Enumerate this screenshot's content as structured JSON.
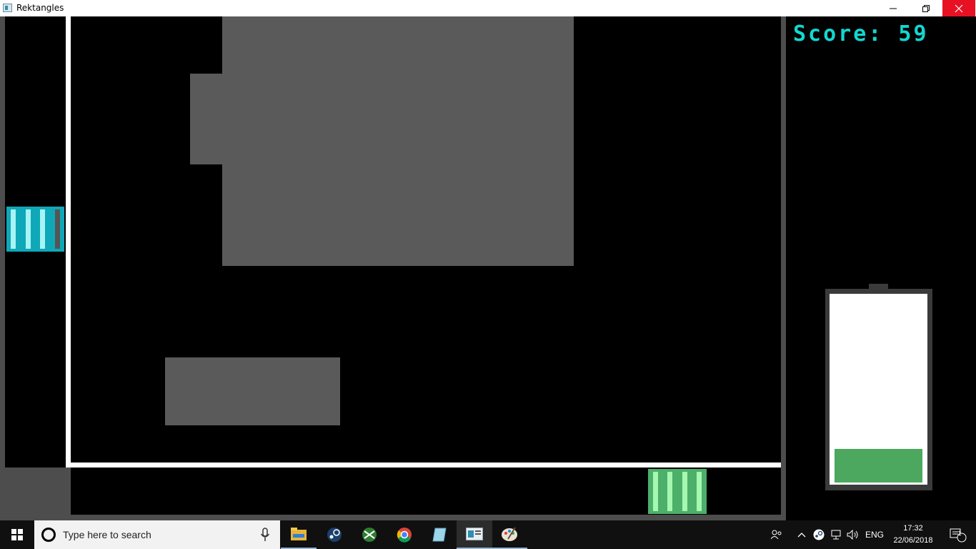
{
  "window": {
    "title": "Rektangles",
    "minimize_icon": "minimize-icon",
    "restore_icon": "restore-icon",
    "close_icon": "close-icon"
  },
  "game": {
    "score_text": "Score: 59",
    "battery_level": 0.18,
    "colors": {
      "left_paddle": "#0fa8b8",
      "bottom_paddle": "#4caf6a",
      "score": "#12d8d0",
      "battery_fill": "#4ba85e",
      "obstacle": "#5a5a5a"
    }
  },
  "taskbar": {
    "start_icon": "windows-start-icon",
    "search_placeholder": "Type here to search",
    "apps": [
      "file-explorer-icon",
      "steam-icon",
      "game-icon",
      "chrome-icon",
      "notepad-icon",
      "app-window-icon",
      "paint-icon"
    ],
    "tray": {
      "language": "ENG",
      "time": "17:32",
      "date": "22/06/2018",
      "notification_count": "1"
    }
  }
}
